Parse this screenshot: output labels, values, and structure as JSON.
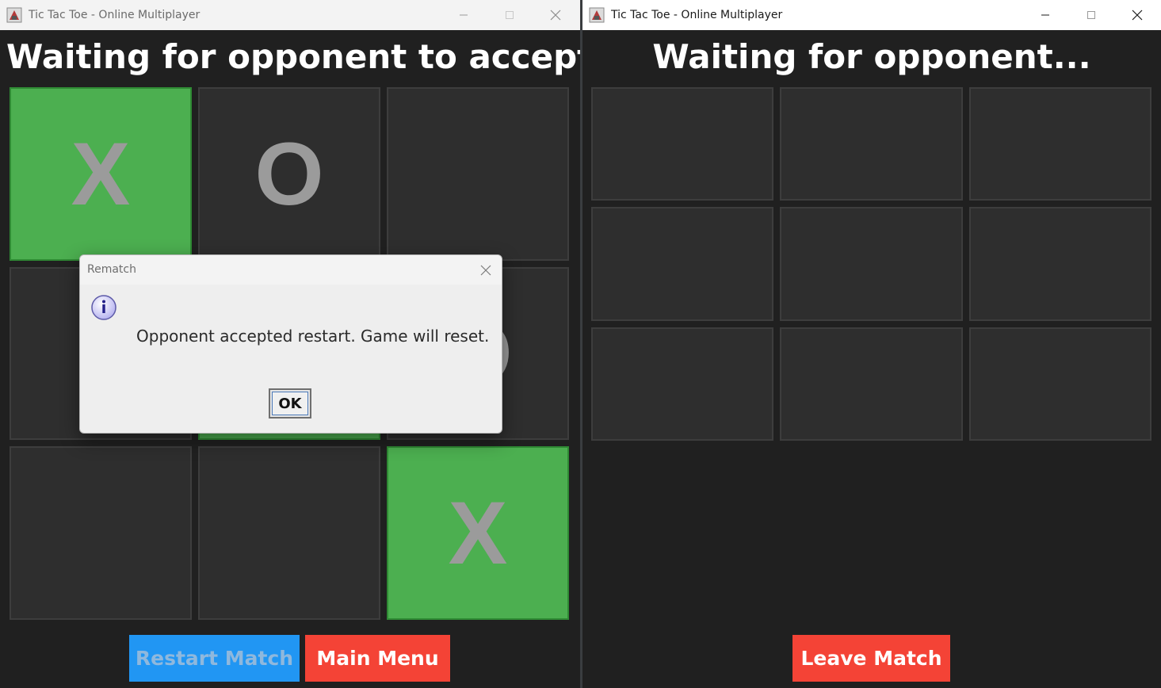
{
  "left_window": {
    "title": "Tic Tac Toe - Online Multiplayer",
    "status": "Waiting for opponent to accept ...",
    "board": [
      "X",
      "O",
      "",
      "",
      "",
      "O",
      "",
      "",
      "X"
    ],
    "winning_cells": [
      0,
      4,
      8
    ],
    "buttons": {
      "restart": "Restart Match",
      "main_menu": "Main Menu"
    }
  },
  "right_window": {
    "title": "Tic Tac Toe - Online Multiplayer",
    "status": "Waiting for opponent...",
    "board": [
      "",
      "",
      "",
      "",
      "",
      "",
      "",
      "",
      ""
    ],
    "buttons": {
      "leave": "Leave Match"
    }
  },
  "dialog": {
    "title": "Rematch",
    "message": "Opponent accepted restart. Game will reset.",
    "ok_label": "OK",
    "icon": "info-icon"
  },
  "colors": {
    "win_cell": "#4caf50",
    "cell": "#2e2e2e",
    "restart_button": "#2196f3",
    "danger_button": "#f44336",
    "background": "#202020"
  }
}
